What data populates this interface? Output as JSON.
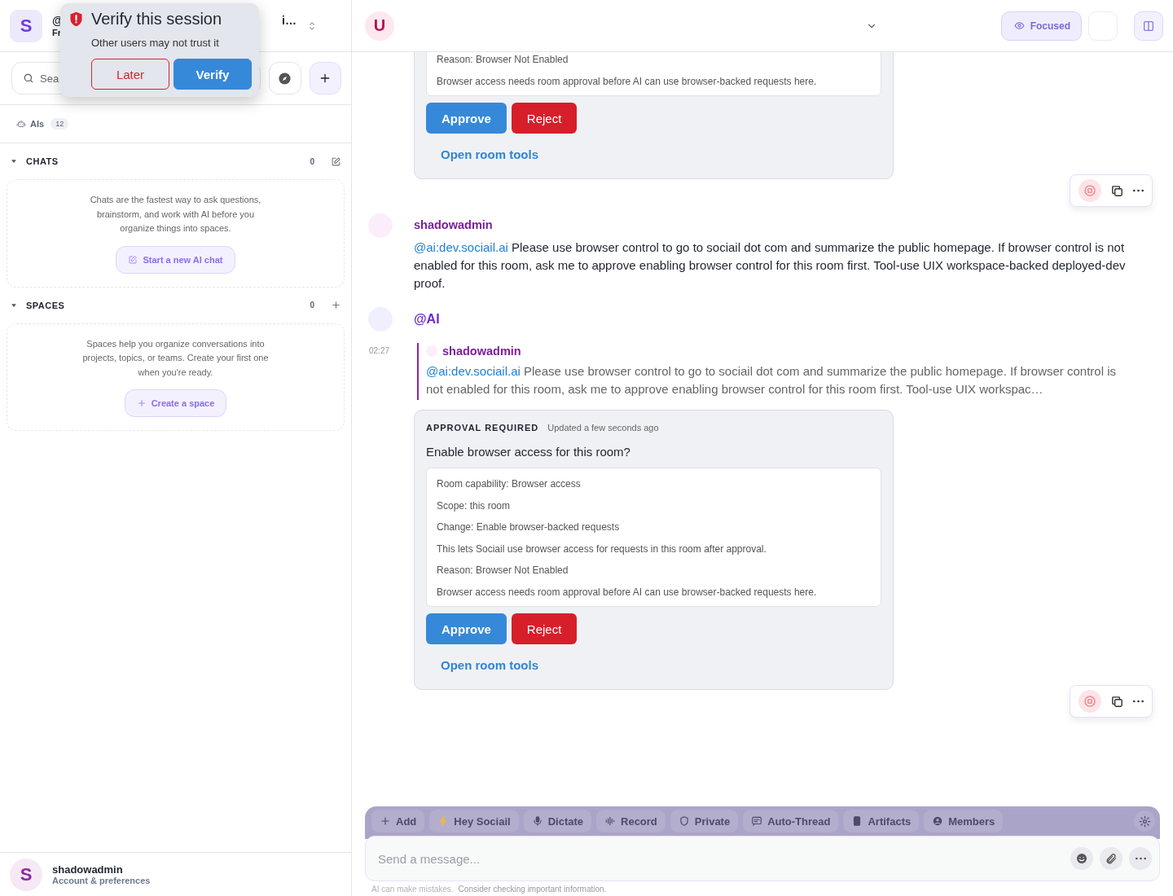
{
  "sidebar": {
    "avatar": "S",
    "header_title_start": "@",
    "header_title_end": "i…",
    "header_subtitle": "Fr",
    "search": {
      "placeholder": "Sea"
    },
    "ais": {
      "label": "AIs",
      "count": "12"
    },
    "sections": [
      {
        "title": "CHATS",
        "count": "0",
        "expanded": true,
        "empty_text": "Chats are the fastest way to ask questions, brainstorm, and work with AI before you organize things into spaces.",
        "button": "Start a new AI chat"
      },
      {
        "title": "SPACES",
        "count": "0",
        "expanded": true,
        "empty_text": "Spaces help you organize conversations into projects, topics, or teams. Create your first one when you're ready.",
        "button": "Create a space"
      }
    ],
    "user": {
      "avatar": "S",
      "name": "shadowadmin",
      "subtitle": "Account & preferences"
    }
  },
  "popup": {
    "title": "Verify this session",
    "text": "Other users may not trust it",
    "buttons": [
      {
        "label": "Later",
        "kind": "secondary"
      },
      {
        "label": "Verify",
        "kind": "primary"
      }
    ]
  },
  "chat": {
    "avatar": "U",
    "focus_button": "Focused",
    "messages": [
      {
        "kind": "approval",
        "details": [
          "Reason: Browser Not Enabled",
          "Browser access needs room approval before AI can use browser-backed requests here."
        ],
        "approve": "Approve",
        "reject": "Reject",
        "link": "Open room tools"
      },
      {
        "kind": "message",
        "author": "shadowadmin",
        "mention": "@ai:dev.sociail.ai",
        "text": " Please use browser control to go to sociail dot com and summarize the public homepage. If browser control is not enabled for this room, ask me to approve enabling browser control for this room first. Tool-use UIX workspace-backed deployed-dev proof."
      },
      {
        "kind": "header",
        "author": "@AI"
      },
      {
        "kind": "quote",
        "time": "02:27",
        "author": "shadowadmin",
        "mention": "@ai:dev.sociail.ai",
        "text": " Please use browser control to go to sociail dot com and summarize the public homepage. If browser control is not enabled for this room, ask me to approve enabling browser control for this room first. Tool-use UIX workspac…"
      },
      {
        "kind": "approval",
        "label": "APPROVAL REQUIRED",
        "updated": "Updated a few seconds ago",
        "question": "Enable browser access for this room?",
        "details": [
          "Room capability: Browser access",
          "Scope: this room",
          "Change: Enable browser-backed requests",
          "This lets Sociail use browser access for requests in this room after approval.",
          "Reason: Browser Not Enabled",
          "Browser access needs room approval before AI can use browser-backed requests here."
        ],
        "approve": "Approve",
        "reject": "Reject",
        "link": "Open room tools"
      }
    ],
    "composer": {
      "chips": [
        {
          "label": "Add"
        },
        {
          "label": "Hey Sociail"
        },
        {
          "label": "Dictate"
        },
        {
          "label": "Record"
        },
        {
          "label": "Private"
        },
        {
          "label": "Auto-Thread"
        },
        {
          "label": "Artifacts"
        },
        {
          "label": "Members"
        }
      ],
      "placeholder": "Send a message...",
      "disclaimer": [
        "AI can make mistakes.",
        "Consider checking important information."
      ]
    }
  }
}
